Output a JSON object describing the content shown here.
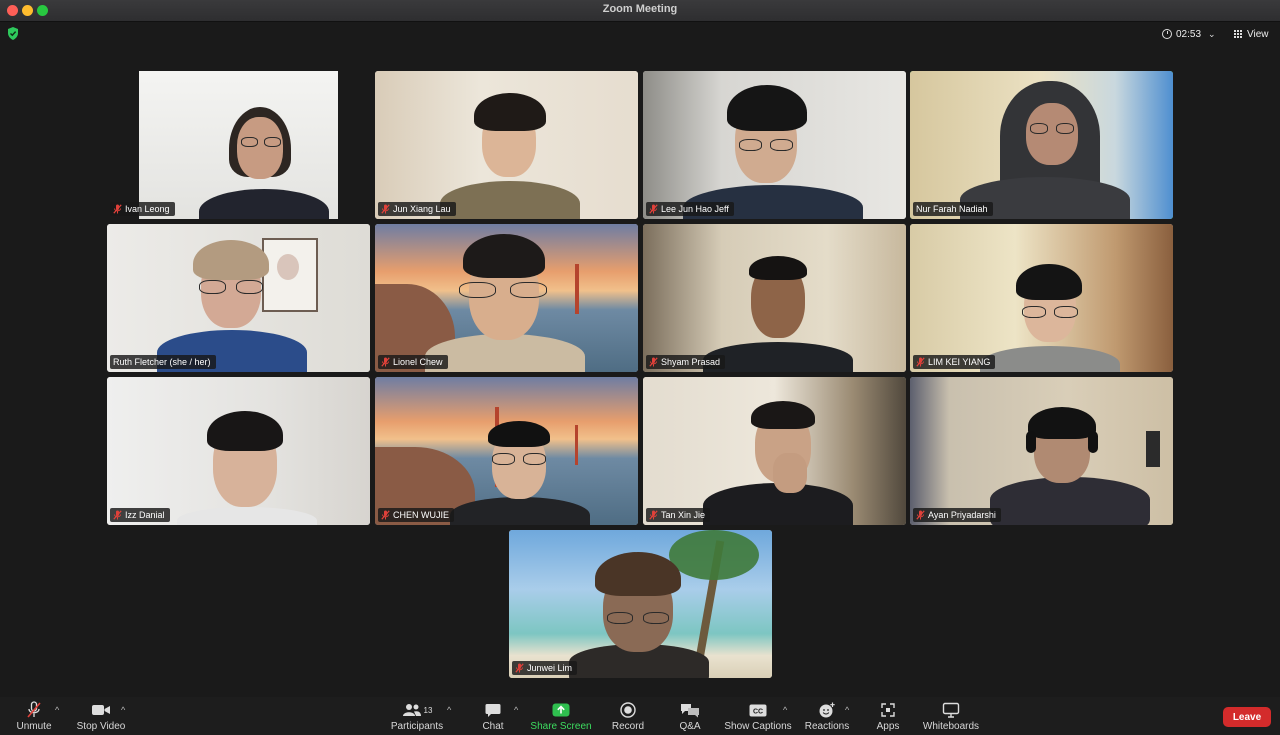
{
  "window": {
    "title": "Zoom Meeting"
  },
  "topbar": {
    "timer": "02:53",
    "view_label": "View"
  },
  "participants": [
    {
      "name": "Ivan Leong",
      "muted": true
    },
    {
      "name": "Jun Xiang Lau",
      "muted": true
    },
    {
      "name": "Lee Jun Hao Jeff",
      "muted": true
    },
    {
      "name": "Nur Farah Nadiah",
      "muted": false,
      "active_speaker": true
    },
    {
      "name": "Ruth Fletcher (she / her)",
      "muted": false
    },
    {
      "name": "Lionel Chew",
      "muted": true
    },
    {
      "name": "Shyam Prasad",
      "muted": true
    },
    {
      "name": "LIM KEI YIANG",
      "muted": true
    },
    {
      "name": "Izz Danial",
      "muted": true
    },
    {
      "name": "CHEN WUJIE",
      "muted": true
    },
    {
      "name": "Tan Xin Jie",
      "muted": true
    },
    {
      "name": "Ayan Priyadarshi",
      "muted": true
    },
    {
      "name": "Junwei Lim",
      "muted": true
    }
  ],
  "toolbar": {
    "unmute": "Unmute",
    "stop_video": "Stop Video",
    "participants": "Participants",
    "participant_count": "13",
    "chat": "Chat",
    "share_screen": "Share Screen",
    "record": "Record",
    "qa": "Q&A",
    "show_captions": "Show Captions",
    "reactions": "Reactions",
    "apps": "Apps",
    "whiteboards": "Whiteboards",
    "leave": "Leave"
  },
  "colors": {
    "active_speaker_border": "#3ecf4a",
    "share_green": "#3ddc60",
    "leave_red": "#d32b2b",
    "mute_red": "#e0413a"
  }
}
